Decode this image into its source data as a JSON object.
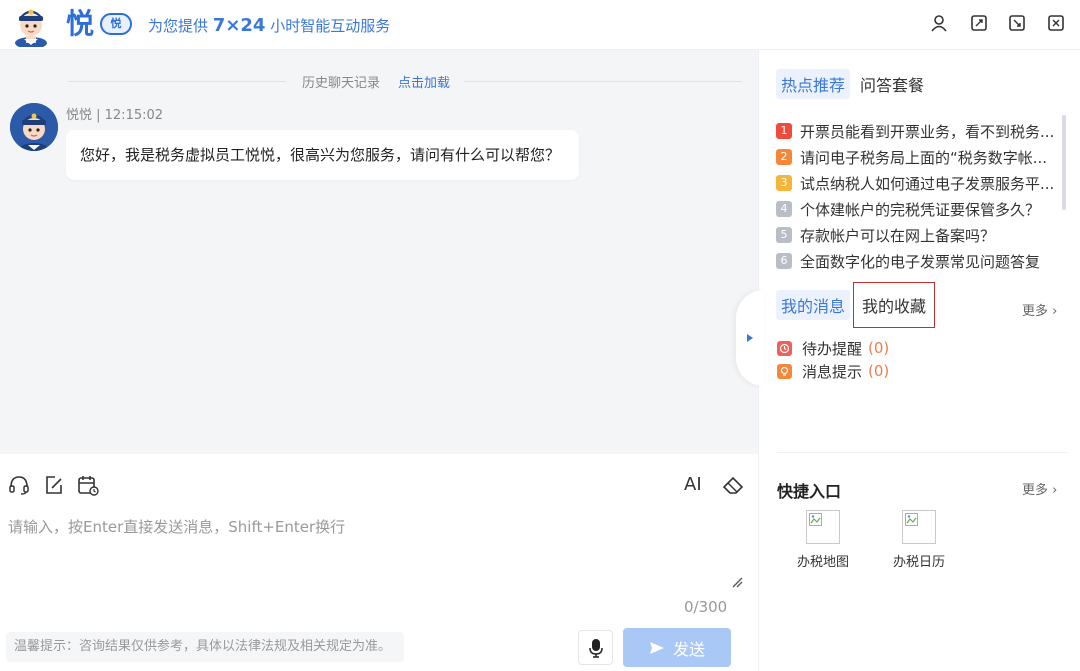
{
  "header": {
    "logo_char": "悦",
    "logo_badge": "悦",
    "tagline_prefix": "为您提供",
    "tagline_big": "7×24",
    "tagline_suffix": "小时智能互动服务",
    "buttons": [
      "user-icon",
      "expand-icon",
      "minimize-icon",
      "close-icon"
    ]
  },
  "chat": {
    "history_label": "历史聊天记录",
    "history_link": "点击加载",
    "message": {
      "sender": "悦悦",
      "time": "12:15:02",
      "meta": "悦悦 | 12:15:02",
      "text": "您好，我是税务虚拟员工悦悦，很高兴为您服务，请问有什么可以帮您？"
    }
  },
  "input": {
    "tools": [
      "headset-icon",
      "edit-icon",
      "calendar-icon"
    ],
    "ai_label": "AI",
    "placeholder": "请输入，按Enter直接发送消息，Shift+Enter换行",
    "counter": "0/300",
    "tip": "温馨提示：咨询结果仅供参考，具体以法律法规及相关规定为准。",
    "send_label": "发送"
  },
  "sidebar": {
    "tabs": [
      "热点推荐",
      "问答套餐"
    ],
    "hot_items": [
      {
        "num": "1",
        "color": "#f04b3c",
        "text": "开票员能看到开票业务，看不到税务..."
      },
      {
        "num": "2",
        "color": "#f6873a",
        "text": "请问电子税务局上面的“税务数字帐..."
      },
      {
        "num": "3",
        "color": "#f4b63a",
        "text": "试点纳税人如何通过电子发票服务平..."
      },
      {
        "num": "4",
        "color": "#b9bdc6",
        "text": "个体建帐户的完税凭证要保管多久？"
      },
      {
        "num": "5",
        "color": "#b9bdc6",
        "text": "存款帐户可以在网上备案吗？"
      },
      {
        "num": "6",
        "color": "#b9bdc6",
        "text": "全面数字化的电子发票常见问题答复"
      }
    ],
    "msg_tabs": [
      "我的消息",
      "我的收藏"
    ],
    "more_label": "更多",
    "messages": [
      {
        "label": "待办提醒",
        "count": "(0)",
        "color": "#f0605a"
      },
      {
        "label": "消息提示",
        "count": "(0)",
        "color": "#f6873a"
      }
    ],
    "quick_title": "快捷入口",
    "quick_items": [
      "办税地图",
      "办税日历"
    ]
  }
}
